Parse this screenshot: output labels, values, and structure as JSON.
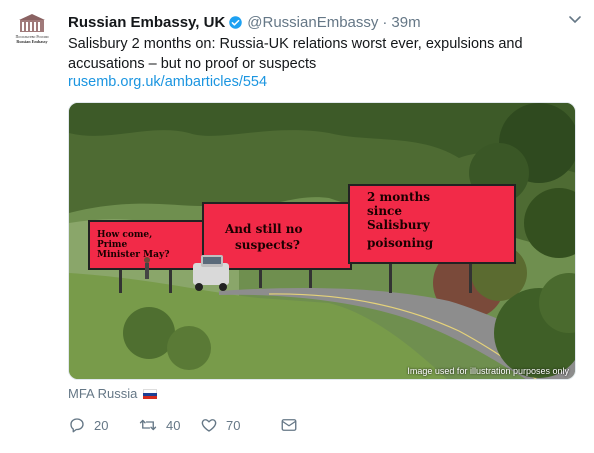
{
  "tweet": {
    "display_name": "Russian Embassy, UK",
    "handle": "@RussianEmbassy",
    "separator": "·",
    "time": "39m",
    "text": "Salisbury 2 months on: Russia-UK relations worst ever, expulsions and accusations – but no proof or suspects",
    "link": "rusemb.org.uk/ambarticles/554",
    "avatar_line1": "Посольство России",
    "avatar_line2": "Russian Embassy",
    "image": {
      "billboard_left": [
        "How come,",
        "Prime",
        "Minister May?"
      ],
      "billboard_middle": [
        "And still no",
        "suspects?"
      ],
      "billboard_right": [
        "2 months",
        "since",
        "Salisbury",
        "poisoning"
      ],
      "caption": "Image used for illustration purposes only"
    },
    "source_label": "MFA Russia",
    "actions": {
      "replies": "20",
      "retweets": "40",
      "likes": "70"
    }
  },
  "colors": {
    "link": "#1b95e0",
    "muted": "#657786",
    "verified": "#1da1f2",
    "billboard": "#f22a48"
  }
}
